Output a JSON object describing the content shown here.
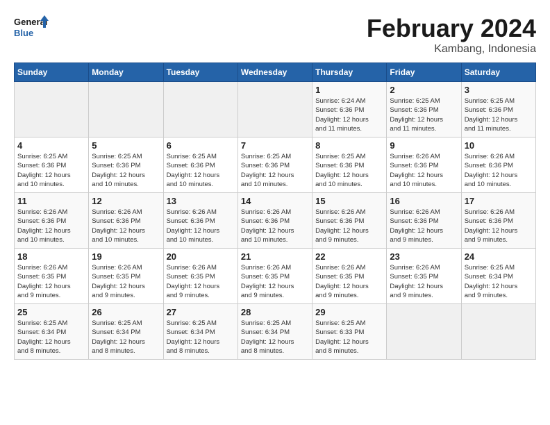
{
  "header": {
    "logo_line1": "General",
    "logo_line2": "Blue",
    "month_year": "February 2024",
    "location": "Kambang, Indonesia"
  },
  "days_of_week": [
    "Sunday",
    "Monday",
    "Tuesday",
    "Wednesday",
    "Thursday",
    "Friday",
    "Saturday"
  ],
  "weeks": [
    [
      {
        "num": "",
        "info": ""
      },
      {
        "num": "",
        "info": ""
      },
      {
        "num": "",
        "info": ""
      },
      {
        "num": "",
        "info": ""
      },
      {
        "num": "1",
        "info": "Sunrise: 6:24 AM\nSunset: 6:36 PM\nDaylight: 12 hours\nand 11 minutes."
      },
      {
        "num": "2",
        "info": "Sunrise: 6:25 AM\nSunset: 6:36 PM\nDaylight: 12 hours\nand 11 minutes."
      },
      {
        "num": "3",
        "info": "Sunrise: 6:25 AM\nSunset: 6:36 PM\nDaylight: 12 hours\nand 11 minutes."
      }
    ],
    [
      {
        "num": "4",
        "info": "Sunrise: 6:25 AM\nSunset: 6:36 PM\nDaylight: 12 hours\nand 10 minutes."
      },
      {
        "num": "5",
        "info": "Sunrise: 6:25 AM\nSunset: 6:36 PM\nDaylight: 12 hours\nand 10 minutes."
      },
      {
        "num": "6",
        "info": "Sunrise: 6:25 AM\nSunset: 6:36 PM\nDaylight: 12 hours\nand 10 minutes."
      },
      {
        "num": "7",
        "info": "Sunrise: 6:25 AM\nSunset: 6:36 PM\nDaylight: 12 hours\nand 10 minutes."
      },
      {
        "num": "8",
        "info": "Sunrise: 6:25 AM\nSunset: 6:36 PM\nDaylight: 12 hours\nand 10 minutes."
      },
      {
        "num": "9",
        "info": "Sunrise: 6:26 AM\nSunset: 6:36 PM\nDaylight: 12 hours\nand 10 minutes."
      },
      {
        "num": "10",
        "info": "Sunrise: 6:26 AM\nSunset: 6:36 PM\nDaylight: 12 hours\nand 10 minutes."
      }
    ],
    [
      {
        "num": "11",
        "info": "Sunrise: 6:26 AM\nSunset: 6:36 PM\nDaylight: 12 hours\nand 10 minutes."
      },
      {
        "num": "12",
        "info": "Sunrise: 6:26 AM\nSunset: 6:36 PM\nDaylight: 12 hours\nand 10 minutes."
      },
      {
        "num": "13",
        "info": "Sunrise: 6:26 AM\nSunset: 6:36 PM\nDaylight: 12 hours\nand 10 minutes."
      },
      {
        "num": "14",
        "info": "Sunrise: 6:26 AM\nSunset: 6:36 PM\nDaylight: 12 hours\nand 10 minutes."
      },
      {
        "num": "15",
        "info": "Sunrise: 6:26 AM\nSunset: 6:36 PM\nDaylight: 12 hours\nand 9 minutes."
      },
      {
        "num": "16",
        "info": "Sunrise: 6:26 AM\nSunset: 6:36 PM\nDaylight: 12 hours\nand 9 minutes."
      },
      {
        "num": "17",
        "info": "Sunrise: 6:26 AM\nSunset: 6:36 PM\nDaylight: 12 hours\nand 9 minutes."
      }
    ],
    [
      {
        "num": "18",
        "info": "Sunrise: 6:26 AM\nSunset: 6:35 PM\nDaylight: 12 hours\nand 9 minutes."
      },
      {
        "num": "19",
        "info": "Sunrise: 6:26 AM\nSunset: 6:35 PM\nDaylight: 12 hours\nand 9 minutes."
      },
      {
        "num": "20",
        "info": "Sunrise: 6:26 AM\nSunset: 6:35 PM\nDaylight: 12 hours\nand 9 minutes."
      },
      {
        "num": "21",
        "info": "Sunrise: 6:26 AM\nSunset: 6:35 PM\nDaylight: 12 hours\nand 9 minutes."
      },
      {
        "num": "22",
        "info": "Sunrise: 6:26 AM\nSunset: 6:35 PM\nDaylight: 12 hours\nand 9 minutes."
      },
      {
        "num": "23",
        "info": "Sunrise: 6:26 AM\nSunset: 6:35 PM\nDaylight: 12 hours\nand 9 minutes."
      },
      {
        "num": "24",
        "info": "Sunrise: 6:25 AM\nSunset: 6:34 PM\nDaylight: 12 hours\nand 9 minutes."
      }
    ],
    [
      {
        "num": "25",
        "info": "Sunrise: 6:25 AM\nSunset: 6:34 PM\nDaylight: 12 hours\nand 8 minutes."
      },
      {
        "num": "26",
        "info": "Sunrise: 6:25 AM\nSunset: 6:34 PM\nDaylight: 12 hours\nand 8 minutes."
      },
      {
        "num": "27",
        "info": "Sunrise: 6:25 AM\nSunset: 6:34 PM\nDaylight: 12 hours\nand 8 minutes."
      },
      {
        "num": "28",
        "info": "Sunrise: 6:25 AM\nSunset: 6:34 PM\nDaylight: 12 hours\nand 8 minutes."
      },
      {
        "num": "29",
        "info": "Sunrise: 6:25 AM\nSunset: 6:33 PM\nDaylight: 12 hours\nand 8 minutes."
      },
      {
        "num": "",
        "info": ""
      },
      {
        "num": "",
        "info": ""
      }
    ]
  ]
}
